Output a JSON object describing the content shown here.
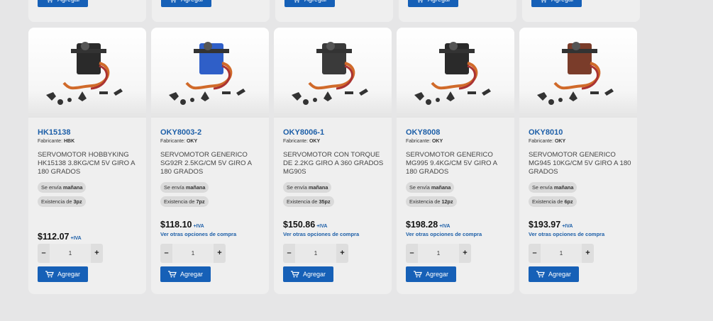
{
  "add_label": "Agregar",
  "iva_label": "+IVA",
  "maker_prefix": "Fabricante: ",
  "more_options_label": "Ver otras opciones de compra",
  "accent_color": "#1660b7",
  "top_buttons": [
    "Agregar",
    "Agregar",
    "Agregar",
    "Agregar",
    "Agregar"
  ],
  "products": [
    {
      "sku": "HK15138",
      "maker": "HBK",
      "description": "SERVOMOTOR HOBBYKING HK15138 3.8KG/CM 5V GIRO A 180 GRADOS",
      "ship_prefix": "Se envía ",
      "ship_day": "mañana",
      "stock_prefix": "Existencia de ",
      "stock": "3pz",
      "price": "$112.07",
      "has_more_options": false,
      "quantity": "1",
      "image_icon": "servo-motor-image"
    },
    {
      "sku": "OKY8003-2",
      "maker": "OKY",
      "description": "SERVOMOTOR GENERICO SG92R 2.5KG/CM 5V GIRO A 180 GRADOS",
      "ship_prefix": "Se envía ",
      "ship_day": "mañana",
      "stock_prefix": "Existencia de ",
      "stock": "7pz",
      "price": "$118.10",
      "has_more_options": true,
      "quantity": "1",
      "image_icon": "servo-motor-image"
    },
    {
      "sku": "OKY8006-1",
      "maker": "OKY",
      "description": "SERVOMOTOR CON TORQUE DE 2.2KG GIRO A 360 GRADOS MG90S",
      "ship_prefix": "Se envía ",
      "ship_day": "mañana",
      "stock_prefix": "Existencia de ",
      "stock": "35pz",
      "price": "$150.86",
      "has_more_options": true,
      "quantity": "1",
      "image_icon": "servo-motor-image"
    },
    {
      "sku": "OKY8008",
      "maker": "OKY",
      "description": "SERVOMOTOR GENERICO MG995 9.4KG/CM 5V GIRO A 180 GRADOS",
      "ship_prefix": "Se envía ",
      "ship_day": "mañana",
      "stock_prefix": "Existencia de ",
      "stock": "12pz",
      "price": "$198.28",
      "has_more_options": true,
      "quantity": "1",
      "image_icon": "servo-motor-image"
    },
    {
      "sku": "OKY8010",
      "maker": "OKY",
      "description": "SERVOMOTOR GENERICO MG945 10KG/CM 5V GIRO A 180 GRADOS",
      "ship_prefix": "Se envía ",
      "ship_day": "mañana",
      "stock_prefix": "Existencia de ",
      "stock": "6pz",
      "price": "$193.97",
      "has_more_options": true,
      "quantity": "1",
      "image_icon": "servo-motor-image"
    }
  ]
}
